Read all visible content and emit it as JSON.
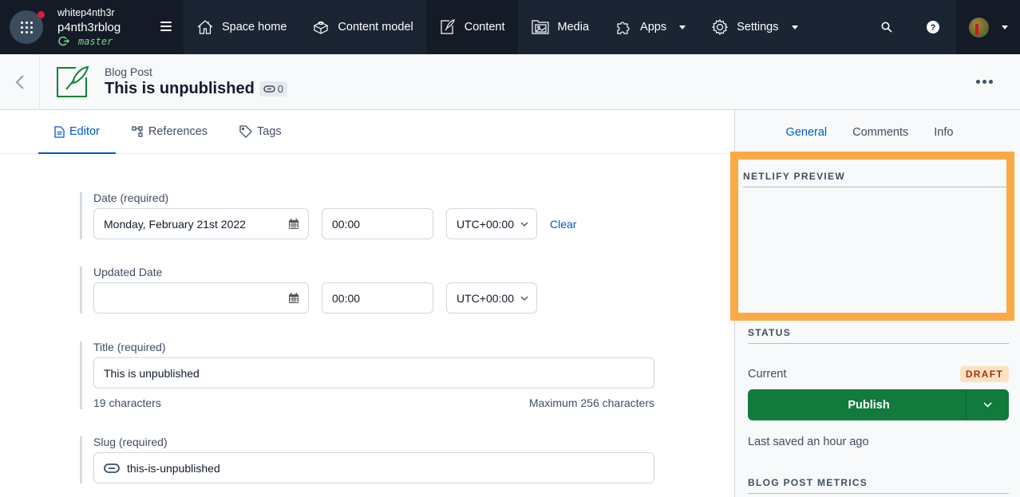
{
  "topnav": {
    "org_name": "whitep4nth3r",
    "space_name": "p4nth3rblog",
    "environment": "master",
    "items": [
      {
        "label": "Space home",
        "icon": "home-icon"
      },
      {
        "label": "Content model",
        "icon": "content-model-icon"
      },
      {
        "label": "Content",
        "icon": "content-icon",
        "active": true
      },
      {
        "label": "Media",
        "icon": "media-icon"
      },
      {
        "label": "Apps",
        "icon": "apps-icon",
        "dropdown": true
      },
      {
        "label": "Settings",
        "icon": "gear-icon",
        "dropdown": true
      }
    ]
  },
  "entry": {
    "content_type": "Blog Post",
    "title": "This is unpublished",
    "references_count": "0"
  },
  "editor": {
    "tabs": [
      {
        "label": "Editor",
        "active": true
      },
      {
        "label": "References"
      },
      {
        "label": "Tags"
      }
    ],
    "fields": {
      "date": {
        "label": "Date (required)",
        "value": "Monday, February 21st 2022",
        "time": "00:00",
        "timezone": "UTC+00:00",
        "clear_label": "Clear"
      },
      "updated_date": {
        "label": "Updated Date",
        "value": "",
        "time": "00:00",
        "timezone": "UTC+00:00"
      },
      "title": {
        "label": "Title (required)",
        "value": "This is unpublished",
        "char_count": "19 characters",
        "max_chars": "Maximum 256 characters"
      },
      "slug": {
        "label": "Slug (required)",
        "value": "this-is-unpublished"
      }
    }
  },
  "sidebar": {
    "tabs": [
      {
        "label": "General",
        "active": true
      },
      {
        "label": "Comments"
      },
      {
        "label": "Info"
      }
    ],
    "netlify_preview_title": "NETLIFY PREVIEW",
    "highlight_color": "#fca944",
    "status": {
      "title": "STATUS",
      "current_label": "Current",
      "badge": "DRAFT",
      "publish_label": "Publish",
      "last_saved": "Last saved an hour ago"
    },
    "metrics_title": "BLOG POST METRICS"
  }
}
